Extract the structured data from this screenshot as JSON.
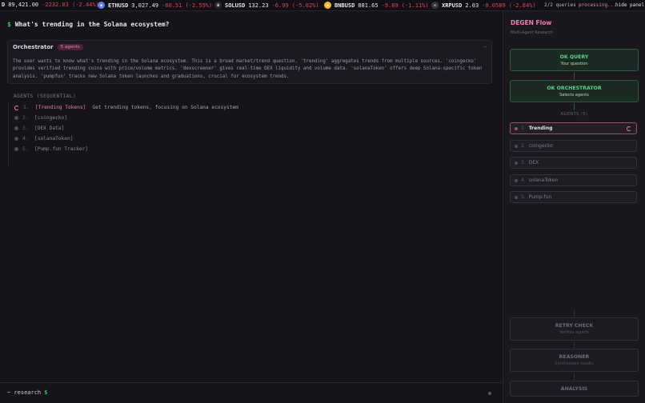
{
  "ticker": {
    "items": [
      {
        "symbol": "D",
        "price": "89,421.00",
        "change": "-2232.83 (-2.44%)"
      },
      {
        "symbol": "ETHUSD",
        "price": "3,027.49",
        "change": "-80.51 (-2.59%)",
        "icon": "ethereum-icon",
        "color": "#627eea"
      },
      {
        "symbol": "SOLUSD",
        "price": "132.23",
        "change": "-6.99 (-5.02%)",
        "icon": "solana-icon",
        "color": "#2b2b2b"
      },
      {
        "symbol": "BNBUSD",
        "price": "881.65",
        "change": "-9.89 (-1.11%)",
        "icon": "bnb-icon",
        "color": "#f3ba2f"
      },
      {
        "symbol": "XRPUSD",
        "price": "2.03",
        "change": "-0.0589 (-2.84%)",
        "icon": "xrp-icon",
        "color": "#3a3a3a"
      }
    ],
    "queries": "2/2 queries",
    "status": "processing...",
    "hide_panel": "hide panel"
  },
  "main": {
    "question": "What's trending in the Solana ecosystem?",
    "orchestrator": {
      "title": "Orchestrator",
      "badge": "5 agents",
      "collapse": "–",
      "text": "The user wants to know what's trending in the Solana ecosystem. This is a broad market/trend question. 'trending' aggregates trends from multiple sources. 'coingecko' provides verified trending coins with price/volume metrics. 'dexscreener' gives real-time DEX liquidity and volume data. 'solanaToken' offers deep Solana-specific token analysis. 'pumpfun' tracks new Solana token launches and graduations, crucial for ecosystem trends."
    },
    "agents_label": "AGENTS (SEQUENTIAL)",
    "agents": [
      {
        "num": "1.",
        "name": "[Trending Tokens]",
        "desc": "Get trending tokens, focusing on Solana ecosystem"
      },
      {
        "num": "2.",
        "name": "[coingecko]",
        "desc": ""
      },
      {
        "num": "3.",
        "name": "[DEX Data]",
        "desc": ""
      },
      {
        "num": "4.",
        "name": "[solanaToken]",
        "desc": ""
      },
      {
        "num": "5.",
        "name": "[Pump.fun Tracker]",
        "desc": ""
      }
    ],
    "prompt": {
      "prefix": "~ research",
      "symbol": "$"
    }
  },
  "panel": {
    "title": "DEGEN Flow",
    "subtitle": "Multi-Agent Research",
    "query": {
      "title": "OK QUERY",
      "sub": "Your question"
    },
    "orchestrator": {
      "title": "OK ORCHESTRATOR",
      "sub": "Selects agents"
    },
    "agents_label": "AGENTS (5)",
    "agents": [
      {
        "num": "1.",
        "name": "Trending"
      },
      {
        "num": "2.",
        "name": "coingecko"
      },
      {
        "num": "3.",
        "name": "DEX"
      },
      {
        "num": "4.",
        "name": "solanaToken"
      },
      {
        "num": "5.",
        "name": "Pump.fun"
      }
    ],
    "retry": {
      "title": "RETRY CHECK",
      "sub": "Verifies agents"
    },
    "reasoner": {
      "title": "REASONER",
      "sub": "Synthesizes results"
    },
    "analysis": {
      "title": "ANALYSIS"
    }
  },
  "colors": {
    "accent": "#f07fb4",
    "positive": "#3fbf6a",
    "negative": "#e0474f"
  }
}
